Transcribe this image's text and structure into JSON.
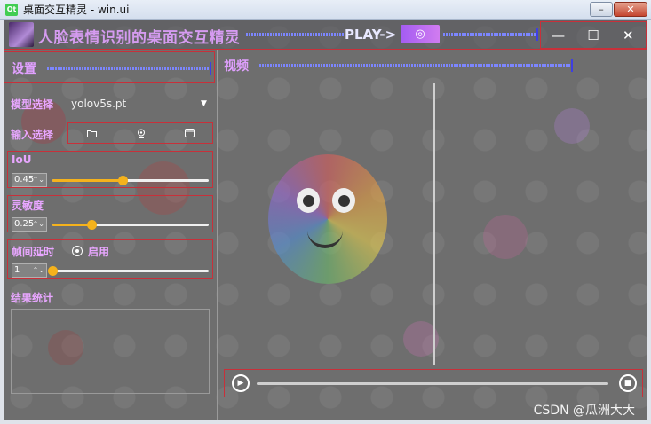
{
  "window": {
    "title": "桌面交互精灵 - win.ui",
    "logo_text": "Qt",
    "min_symbol": "–",
    "close_symbol": "✕"
  },
  "topbar": {
    "title": "人脸表情识别的桌面交互精灵",
    "play_label": "PLAY->",
    "play_button_symbol": "◎",
    "min_symbol": "—",
    "max_symbol": "☐",
    "close_symbol": "✕"
  },
  "settings": {
    "title": "设置",
    "model_label": "模型选择",
    "model_value": "yolov5s.pt",
    "input_label": "输入选择",
    "input_icons": [
      "folder-icon",
      "webcam-icon",
      "window-icon"
    ],
    "iou_label": "IoU",
    "iou_value": "0.45",
    "iou_fraction": 0.45,
    "sensitivity_label": "灵敏度",
    "sensitivity_value": "0.25",
    "sensitivity_fraction": 0.25,
    "delay_label": "帧间延时",
    "delay_enable_label": "启用",
    "delay_value": "1",
    "delay_fraction": 0.0,
    "results_title": "结果统计"
  },
  "video": {
    "title": "视频"
  },
  "watermark": "CSDN @瓜洲大大",
  "colors": {
    "accent": "#f5b21c",
    "label": "#e8a6ff",
    "border": "#c8303a",
    "play_button": "#b56af0"
  }
}
